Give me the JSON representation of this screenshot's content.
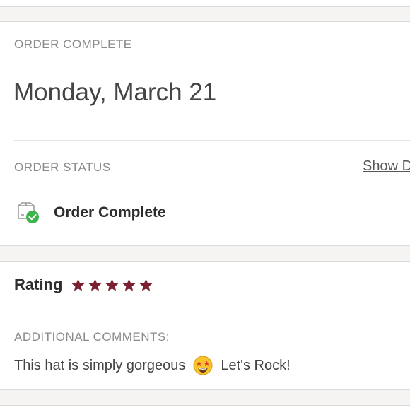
{
  "order": {
    "section_label": "ORDER COMPLETE",
    "date": "Monday, March 21"
  },
  "status": {
    "section_label": "ORDER STATUS",
    "show_link": "Show D",
    "text": "Order Complete",
    "icon": "package-check-icon",
    "check_color": "#3cb44b"
  },
  "rating": {
    "label": "Rating",
    "stars": 5,
    "max_stars": 5,
    "star_color": "#7a2030"
  },
  "comments": {
    "label": "ADDITIONAL COMMENTS:",
    "text_before": "This hat is simply gorgeous",
    "emoji": "star-struck-emoji-icon",
    "text_after": "Let's Rock!"
  }
}
